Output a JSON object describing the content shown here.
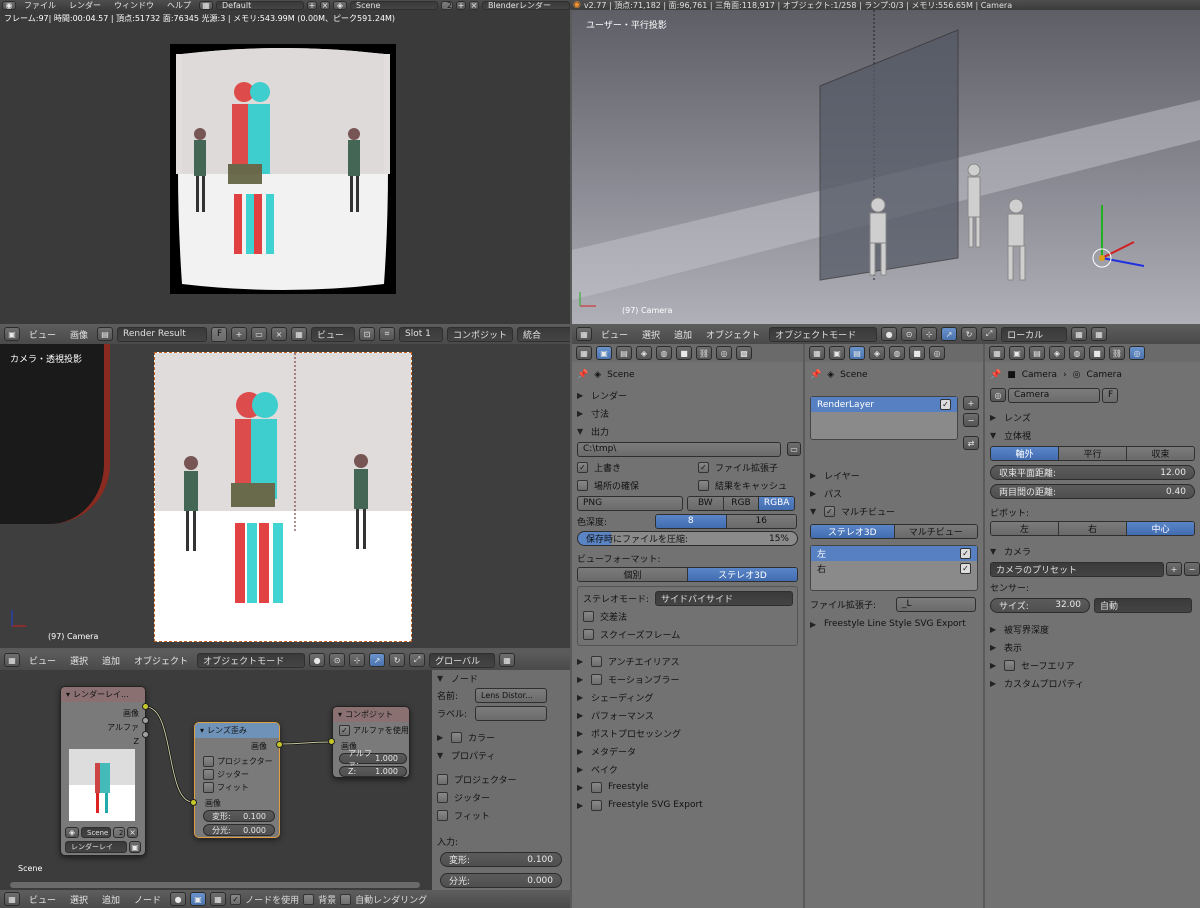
{
  "topbar": {
    "menus": [
      "ファイル",
      "レンダー",
      "ウィンドウ",
      "ヘルプ"
    ],
    "layout": "Default",
    "scene": "Scene",
    "scene_users": "2",
    "engine": "Blenderレンダー",
    "stats": "v2.77 | 頂点:71,182 | 面:96,761 | 三角面:118,917 | オブジェクト:1/258 | ランプ:0/3 | メモリ:556.65M | Camera"
  },
  "render_view": {
    "info": "フレーム:97| 時間:00:04.57 | 頂点:51732 面:76345 光源:3 | メモリ:543.99M (0.00M、ピーク591.24M)"
  },
  "user_view": {
    "label": "ユーザー・平行投影",
    "object_label": "(97) Camera"
  },
  "image_editor_header": {
    "menus": [
      "ビュー",
      "画像"
    ],
    "image_name": "Render Result",
    "fake_user": "F",
    "view_menu": "ビュー",
    "slot": "Slot 1",
    "pass": "コンポジット",
    "layer": "統合"
  },
  "camera_view": {
    "label": "カメラ・透視投影",
    "object_label": "(97) Camera"
  },
  "camera_view_header": {
    "menus": [
      "ビュー",
      "選択",
      "追加",
      "オブジェクト"
    ],
    "mode": "オブジェクトモード",
    "orientation": "グローバル"
  },
  "user_view_header": {
    "menus": [
      "ビュー",
      "選択",
      "追加",
      "オブジェクト"
    ],
    "mode": "オブジェクトモード",
    "orientation": "ローカル"
  },
  "node_editor": {
    "scene_label": "Scene",
    "render_layers_node": {
      "title": "レンダーレイ...",
      "outputs": [
        "画像",
        "アルファ",
        "Z"
      ],
      "scene": "Scene",
      "scene_users": "2",
      "layer": "レンダーレイ"
    },
    "lens_node": {
      "title": "レンズ歪み",
      "output": "画像",
      "options": [
        "プロジェクター",
        "ジッター",
        "フィット"
      ],
      "input_label": "画像",
      "distort_label": "変形:",
      "distort_value": "0.100",
      "dispersion_label": "分光:",
      "dispersion_value": "0.000"
    },
    "composite_node": {
      "title": "コンポジット",
      "use_alpha": "アルファを使用",
      "input_label": "画像",
      "alpha_label": "アルファ:",
      "alpha_value": "1.000",
      "z_label": "Z:",
      "z_value": "1.000"
    },
    "footer_menus": [
      "ビュー",
      "選択",
      "追加",
      "ノード"
    ],
    "use_nodes": "ノードを使用",
    "backdrop": "背景",
    "auto_render": "自動レンダリング"
  },
  "node_sidebar": {
    "node_section": "ノード",
    "name_label": "名前:",
    "name_value": "Lens Distor...",
    "label_label": "ラベル:",
    "color_section": "カラー",
    "props_section": "プロパティ",
    "options": [
      "プロジェクター",
      "ジッター",
      "フィット"
    ],
    "input_label": "入力:",
    "distort_label": "変形:",
    "distort_value": "0.100",
    "dispersion_label": "分光:",
    "dispersion_value": "0.000"
  },
  "render_props": {
    "scene": "Scene",
    "sections_top": [
      "レンダー",
      "寸法"
    ],
    "output_section": "出力",
    "path": "C:\\tmp\\",
    "overwrite": "上書き",
    "file_ext": "ファイル拡張子",
    "placeholders": "場所の確保",
    "cache": "結果をキャッシュ",
    "format": "PNG",
    "color_modes": [
      "BW",
      "RGB",
      "RGBA"
    ],
    "depth_label": "色深度:",
    "depths": [
      "8",
      "16"
    ],
    "compression_label": "保存時にファイルを圧縮:",
    "compression_value": "15%",
    "views_format_label": "ビューフォーマット:",
    "views_format": [
      "個別",
      "ステレオ3D"
    ],
    "stereo_mode_label": "ステレオモード:",
    "stereo_mode": "サイドバイサイド",
    "crossed": "交差法",
    "squeezed": "スクイーズフレーム",
    "sections_bottom": [
      "アンチエイリアス",
      "モーションブラー",
      "シェーディング",
      "パフォーマンス",
      "ポストプロセッシング",
      "メタデータ",
      "ベイク",
      "Freestyle",
      "Freestyle SVG Export"
    ]
  },
  "layer_props": {
    "scene": "Scene",
    "layer_name": "RenderLayer",
    "sections": [
      "レイヤー",
      "パス"
    ],
    "multiview_section": "マルチビュー",
    "modes": [
      "ステレオ3D",
      "マルチビュー"
    ],
    "views": [
      "左",
      "右"
    ],
    "suffix_label": "ファイル拡張子:",
    "suffix_value": "_L",
    "freestyle": "Freestyle Line Style SVG Export"
  },
  "camera_props": {
    "breadcrumb_object": "Camera",
    "breadcrumb_data": "Camera",
    "data_name": "Camera",
    "fake_user": "F",
    "lens_section": "レンズ",
    "stereo_section": "立体視",
    "stereo_modes": [
      "軸外",
      "平行",
      "収束"
    ],
    "convergence_label": "収束平面距離:",
    "convergence_value": "12.00",
    "interocular_label": "両目間の距離:",
    "interocular_value": "0.40",
    "pivot_label": "ピボット:",
    "pivots": [
      "左",
      "右",
      "中心"
    ],
    "camera_section": "カメラ",
    "presets": "カメラのプリセット",
    "sensor_label": "センサー:",
    "size_label": "サイズ:",
    "size_value": "32.00",
    "fit": "自動",
    "sections": [
      "被写界深度",
      "表示",
      "セーフエリア",
      "カスタムプロパティ"
    ]
  }
}
